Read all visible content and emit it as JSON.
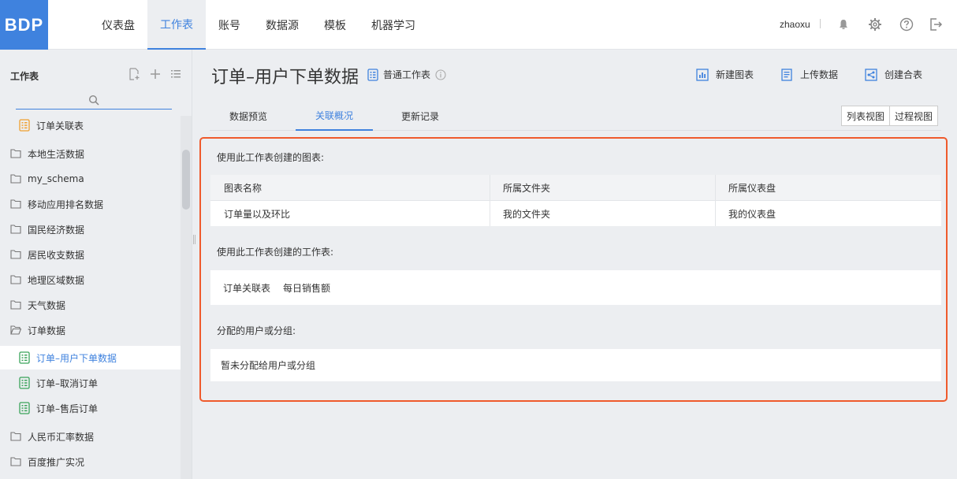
{
  "logo": "BDP",
  "nav": [
    "仪表盘",
    "工作表",
    "账号",
    "数据源",
    "模板",
    "机器学习"
  ],
  "user": "zhaoxu",
  "sidebar": {
    "title": "工作表",
    "items": [
      {
        "label": "订单关联表",
        "type": "worksheet-orange"
      },
      {
        "label": "本地生活数据",
        "type": "folder"
      },
      {
        "label": "my_schema",
        "type": "folder"
      },
      {
        "label": "移动应用排名数据",
        "type": "folder"
      },
      {
        "label": "国民经济数据",
        "type": "folder"
      },
      {
        "label": "居民收支数据",
        "type": "folder"
      },
      {
        "label": "地理区域数据",
        "type": "folder"
      },
      {
        "label": "天气数据",
        "type": "folder"
      },
      {
        "label": "订单数据",
        "type": "folder-open"
      },
      {
        "label": "订单–用户下单数据",
        "type": "worksheet-green"
      },
      {
        "label": "订单–取消订单",
        "type": "worksheet-green"
      },
      {
        "label": "订单–售后订单",
        "type": "worksheet-green"
      },
      {
        "label": "人民币汇率数据",
        "type": "folder"
      },
      {
        "label": "百度推广实况",
        "type": "folder"
      }
    ]
  },
  "main": {
    "title": "订单–用户下单数据",
    "type_label": "普通工作表",
    "actions": [
      "新建图表",
      "上传数据",
      "创建合表"
    ],
    "tabs": [
      "数据预览",
      "关联概况",
      "更新记录"
    ],
    "views": [
      "列表视图",
      "过程视图"
    ],
    "section1": {
      "label": "使用此工作表创建的图表:",
      "headers": [
        "图表名称",
        "所属文件夹",
        "所属仪表盘"
      ],
      "row": [
        "订单量以及环比",
        "我的文件夹",
        "我的仪表盘"
      ]
    },
    "section2": {
      "label": "使用此工作表创建的工作表:",
      "items": [
        "订单关联表",
        "每日销售额"
      ]
    },
    "section3": {
      "label": "分配的用户或分组:",
      "empty": "暂未分配给用户或分组"
    }
  },
  "colors": {
    "accent": "#3f82de",
    "highlight": "#ef5a2c",
    "worksheet_green": "#3aa35a",
    "worksheet_orange": "#f0a030"
  }
}
